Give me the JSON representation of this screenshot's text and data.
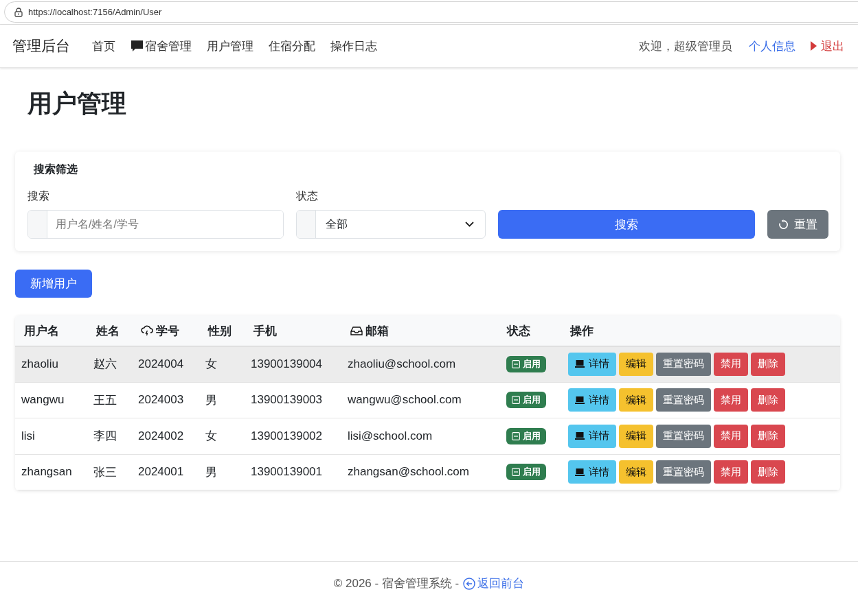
{
  "browser": {
    "url": "https://localhost:7156/Admin/User"
  },
  "navbar": {
    "brand": "管理后台",
    "items": [
      {
        "label": "首页"
      },
      {
        "label": "宿舍管理"
      },
      {
        "label": "用户管理"
      },
      {
        "label": "住宿分配"
      },
      {
        "label": "操作日志"
      }
    ],
    "welcome": "欢迎，超级管理员",
    "profile": "个人信息",
    "logout": "退出"
  },
  "page_title": "用户管理",
  "filter": {
    "title": "搜索筛选",
    "search_label": "搜索",
    "search_placeholder": "用户名/姓名/学号",
    "status_label": "状态",
    "status_value": "全部",
    "search_button": "搜索",
    "reset_button": "重置"
  },
  "add_button": "新增用户",
  "table": {
    "columns": [
      "用户名",
      "姓名",
      "学号",
      "性别",
      "手机",
      "邮箱",
      "状态",
      "操作"
    ],
    "rows": [
      {
        "selected": true,
        "cells": [
          "zhaoliu",
          "赵六",
          "2024004",
          "女",
          "13900139004",
          "zhaoliu@school.com"
        ],
        "status": {
          "label": "启用",
          "enabled": true
        },
        "actions": [
          {
            "label": "详情",
            "kind": "info"
          },
          {
            "label": "编辑",
            "kind": "warning"
          },
          {
            "label": "重置密码",
            "kind": "secondary"
          },
          {
            "label": "禁用",
            "kind": "danger"
          },
          {
            "label": "删除",
            "kind": "danger"
          }
        ]
      },
      {
        "selected": false,
        "cells": [
          "wangwu",
          "王五",
          "2024003",
          "男",
          "13900139003",
          "wangwu@school.com"
        ],
        "status": {
          "label": "启用",
          "enabled": true
        },
        "actions": [
          {
            "label": "详情",
            "kind": "info"
          },
          {
            "label": "编辑",
            "kind": "warning"
          },
          {
            "label": "重置密码",
            "kind": "secondary"
          },
          {
            "label": "禁用",
            "kind": "danger"
          },
          {
            "label": "删除",
            "kind": "danger"
          }
        ]
      },
      {
        "selected": false,
        "cells": [
          "lisi",
          "李四",
          "2024002",
          "女",
          "13900139002",
          "lisi@school.com"
        ],
        "status": {
          "label": "启用",
          "enabled": true
        },
        "actions": [
          {
            "label": "详情",
            "kind": "info"
          },
          {
            "label": "编辑",
            "kind": "warning"
          },
          {
            "label": "重置密码",
            "kind": "secondary"
          },
          {
            "label": "禁用",
            "kind": "danger"
          },
          {
            "label": "删除",
            "kind": "danger"
          }
        ]
      },
      {
        "selected": false,
        "cells": [
          "zhangsan",
          "张三",
          "2024001",
          "男",
          "13900139001",
          "zhangsan@school.com"
        ],
        "status": {
          "label": "启用",
          "enabled": true
        },
        "actions": [
          {
            "label": "详情",
            "kind": "info"
          },
          {
            "label": "编辑",
            "kind": "warning"
          },
          {
            "label": "重置密码",
            "kind": "secondary"
          },
          {
            "label": "禁用",
            "kind": "danger"
          },
          {
            "label": "删除",
            "kind": "danger"
          }
        ]
      }
    ]
  },
  "footer": {
    "text": "© 2026 - 宿舍管理系统 -",
    "link": "返回前台"
  }
}
